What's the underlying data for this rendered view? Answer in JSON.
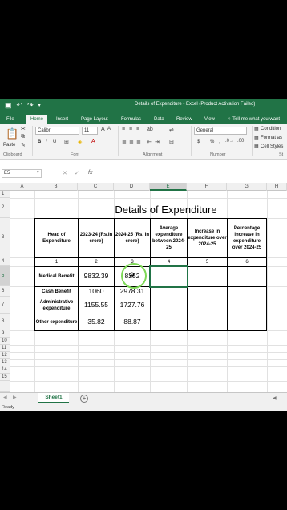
{
  "window": {
    "title": "Details of Expenditure - Excel (Product Activation Failed)"
  },
  "tabs": [
    "File",
    "Home",
    "Insert",
    "Page Layout",
    "Formulas",
    "Data",
    "Review",
    "View"
  ],
  "tell_me": "Tell me what you want",
  "ribbon": {
    "paste_label": "Paste",
    "font_name": "Calibri",
    "font_size": "11",
    "number_format": "General",
    "conditional_label": "Condition",
    "format_as_label": "Format as",
    "cell_styles_label": "Cell Styles",
    "groups": {
      "clipboard": "Clipboard",
      "font": "Font",
      "alignment": "Alignment",
      "number": "Number",
      "styles": "St"
    },
    "currency_symbol": "$",
    "percent_symbol": "%"
  },
  "formula_bar": {
    "name_box": "E5",
    "fx_label": "fx",
    "content": ""
  },
  "grid": {
    "columns": [
      "A",
      "B",
      "C",
      "D",
      "E",
      "F",
      "G",
      "H"
    ],
    "selected_column": "E",
    "rows": [
      "1",
      "2",
      "3",
      "4",
      "5",
      "6",
      "7",
      "8",
      "9",
      "10",
      "11",
      "12",
      "13",
      "14",
      "15"
    ],
    "selected_row": "5"
  },
  "sheet": {
    "title": "Details of Expenditure",
    "headers": [
      "Head of Expenditure",
      "2023-24 (Rs.In crore)",
      "2024-25 (Rs. In crore)",
      "Average expenditure between 2024-25",
      "Increase in expenditure over 2024-25",
      "Percentage increase in expenditure over 2024-25"
    ],
    "index_row": [
      "1",
      "2",
      "3",
      "4",
      "5",
      "6"
    ],
    "rows": [
      {
        "head": "Medical Benefit",
        "y2023": "9832.39",
        "y2024": "8252"
      },
      {
        "head": "Cash Benefit",
        "y2023": "1060",
        "y2024": "2978.31"
      },
      {
        "head": "Administrative expenditure",
        "y2023": "1155.55",
        "y2024": "1727.76"
      },
      {
        "head": "Other expenditure",
        "y2023": "35.82",
        "y2024": "88.87"
      }
    ]
  },
  "sheet_tabs": [
    "Sheet1"
  ],
  "status": "Ready",
  "colors": {
    "excel_green": "#217346",
    "highlight_ring": "#7ed957"
  }
}
